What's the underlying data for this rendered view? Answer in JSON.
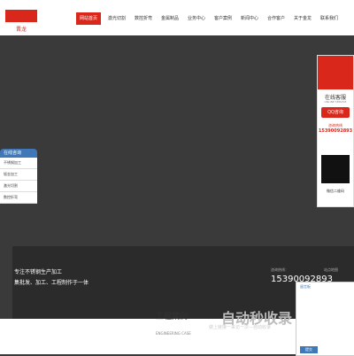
{
  "header": {
    "logo_label": "晋龙",
    "nav": [
      "网站首页",
      "激光切割",
      "数控折弯",
      "金属制品",
      "业务中心",
      "客户案例",
      "新闻中心",
      "合作客户",
      "关于金龙",
      "联系我们"
    ],
    "nav_active_index": 0
  },
  "sidebar": {
    "title": "在线咨询",
    "items": [
      "不锈钢加工",
      "钣金加工",
      "激光切割",
      "数控折弯"
    ]
  },
  "side_panel": {
    "title": "在线客服",
    "subtitle": "ONLINE SERVICE",
    "qq": "QQ咨询",
    "hotline_label": "咨询热线",
    "hotline": "15390092893",
    "qr_label": "微信二维码"
  },
  "footer": {
    "line1": "专注不锈钢生产加工",
    "line2": "集批发、加工、工程制作于一体",
    "phone_label": "咨询热线：",
    "phone": "15390092893",
    "right": "站点地图"
  },
  "contact_box": {
    "title": "留言板",
    "submit": "提交"
  },
  "section": {
    "title": "工程案例",
    "subtitle": "ENGINEERING CASE"
  },
  "watermark": {
    "text": "自动秒收录",
    "sub": "做上链接一来访一次—自动收录"
  },
  "colors": {
    "brand": "#d9271b",
    "accent": "#3e78b9"
  }
}
